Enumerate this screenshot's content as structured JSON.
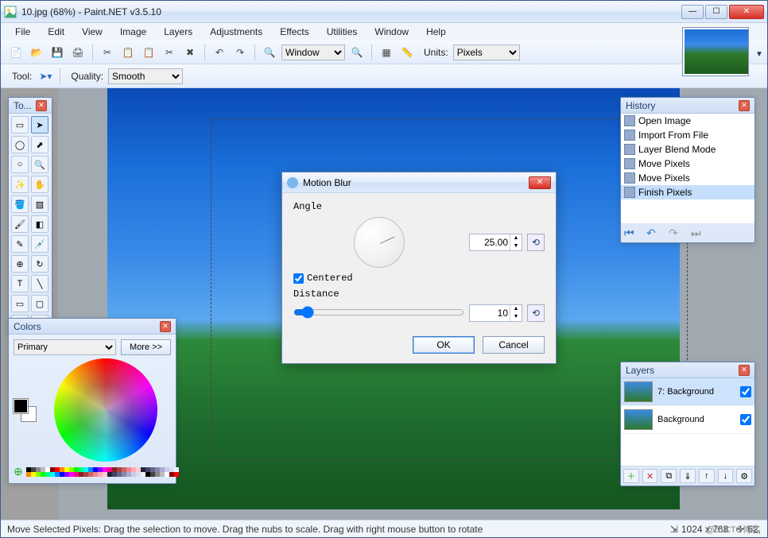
{
  "titlebar": {
    "title": "10.jpg (68%) - Paint.NET v3.5.10"
  },
  "menu": {
    "items": [
      "File",
      "Edit",
      "View",
      "Image",
      "Layers",
      "Adjustments",
      "Effects",
      "Utilities",
      "Window",
      "Help"
    ]
  },
  "toolbar1": {
    "zoom_mode": "Window",
    "units_label": "Units:",
    "units_value": "Pixels"
  },
  "toolbar2": {
    "tool_label": "Tool:",
    "quality_label": "Quality:",
    "quality_value": "Smooth"
  },
  "panels": {
    "tools_title": "To...",
    "colors_title": "Colors",
    "colors_primary_label": "Primary",
    "colors_more": "More >>",
    "history_title": "History",
    "layers_title": "Layers"
  },
  "history": {
    "items": [
      {
        "label": "Open Image"
      },
      {
        "label": "Import From File"
      },
      {
        "label": "Layer Blend Mode"
      },
      {
        "label": "Move Pixels"
      },
      {
        "label": "Move Pixels"
      },
      {
        "label": "Finish Pixels"
      }
    ],
    "selected_index": 5
  },
  "layers": {
    "items": [
      {
        "label": "7: Background",
        "checked": true,
        "selected": true
      },
      {
        "label": "Background",
        "checked": true,
        "selected": false
      }
    ]
  },
  "dialog": {
    "title": "Motion Blur",
    "angle_label": "Angle",
    "angle_value": "25.00",
    "centered_label": "Centered",
    "centered_checked": true,
    "distance_label": "Distance",
    "distance_value": "10",
    "ok": "OK",
    "cancel": "Cancel"
  },
  "statusbar": {
    "hint": "Move Selected Pixels: Drag the selection to move. Drag the nubs to scale. Drag with right mouse button to rotate",
    "image_size": "1024 x 768",
    "cursor": "62,",
    "watermark": "@51CTO博客"
  }
}
